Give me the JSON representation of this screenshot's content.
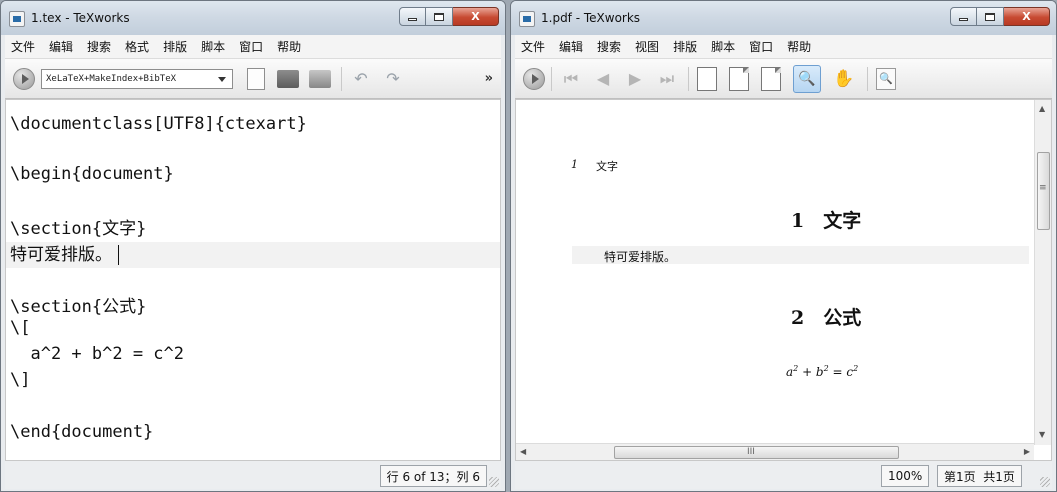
{
  "editor_window": {
    "title": "1.tex - TeXworks",
    "menu": [
      "文件",
      "编辑",
      "搜索",
      "格式",
      "排版",
      "脚本",
      "窗口",
      "帮助"
    ],
    "engine": "XeLaTeX+MakeIndex+BibTeX",
    "overflow_label": "»",
    "code": {
      "l1": "\\documentclass[UTF8]{ctexart}",
      "l2": "\\begin{document}",
      "l3": "\\section{文字}",
      "l4": "特可爱排版。",
      "l5": "\\section{公式}",
      "l6": "\\[",
      "l7": "  a^2 + b^2 = c^2",
      "l8": "\\]",
      "l9": "\\end{document}"
    },
    "status": "行 6 of 13；列 6"
  },
  "viewer_window": {
    "title": "1.pdf - TeXworks",
    "menu": [
      "文件",
      "编辑",
      "搜索",
      "视图",
      "排版",
      "脚本",
      "窗口",
      "帮助"
    ],
    "pdf": {
      "header_num": "1",
      "header_title": "文字",
      "section1": "1　文字",
      "body_text": "特可爱排版。",
      "section2": "2　公式"
    },
    "scroll_marks": {
      "up": "▲",
      "down": "▼",
      "left": "◀",
      "right": "▶",
      "grip_v": "≡",
      "grip_h": "III"
    },
    "status": {
      "zoom": "100%",
      "page": "第1页",
      "total": "共1页"
    }
  },
  "caption": {
    "close": "X"
  }
}
